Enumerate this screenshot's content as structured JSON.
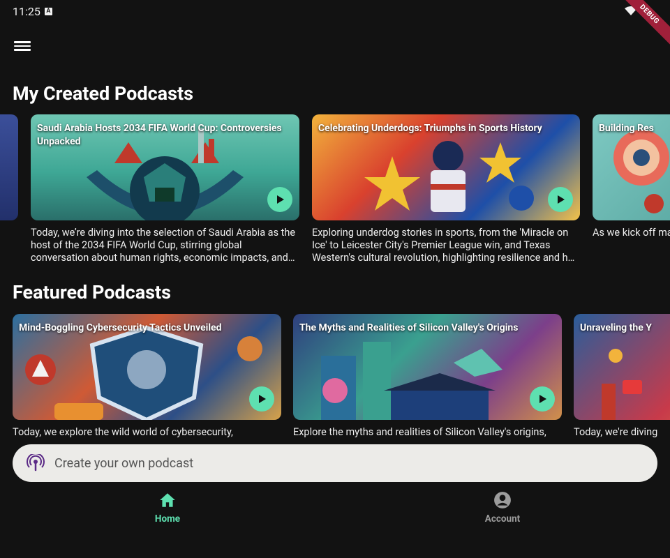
{
  "status": {
    "time": "11:25",
    "badge": "A",
    "debug": "DEBUG"
  },
  "sections": {
    "created_title": "My Created Podcasts",
    "featured_title": "Featured Podcasts"
  },
  "created": [
    {
      "title": "Saudi Arabia Hosts 2034 FIFA World Cup: Controversies Unpacked",
      "desc": "Today, we’re diving into the selection of Saudi Arabia as the host of the 2034 FIFA World Cup, stirring global conversation about human rights, economic impacts, and…"
    },
    {
      "title": "Celebrating Underdogs: Triumphs in Sports History",
      "desc": "Exploring underdog stories in sports, from the 'Miracle on Ice' to Leicester City's Premier League win, and Texas Western's cultural revolution, highlighting resilience and h…"
    },
    {
      "title": "Building Res",
      "desc": "As we kick off managing anx triggers, devel"
    }
  ],
  "featured": [
    {
      "title": "Mind-Boggling Cybersecurity Tactics Unveiled",
      "desc": "Today, we explore the wild world of cybersecurity,"
    },
    {
      "title": "The Myths and Realities of Silicon Valley's Origins",
      "desc": "Explore the myths and realities of Silicon Valley's origins,"
    },
    {
      "title": "Unraveling the Y",
      "desc": "Today, we're diving"
    }
  ],
  "create_bar": {
    "label": "Create your own podcast"
  },
  "nav": {
    "home": "Home",
    "account": "Account"
  },
  "colors": {
    "accent": "#5ee0b0",
    "background": "#121212",
    "create_bar": "#ecebe8"
  }
}
